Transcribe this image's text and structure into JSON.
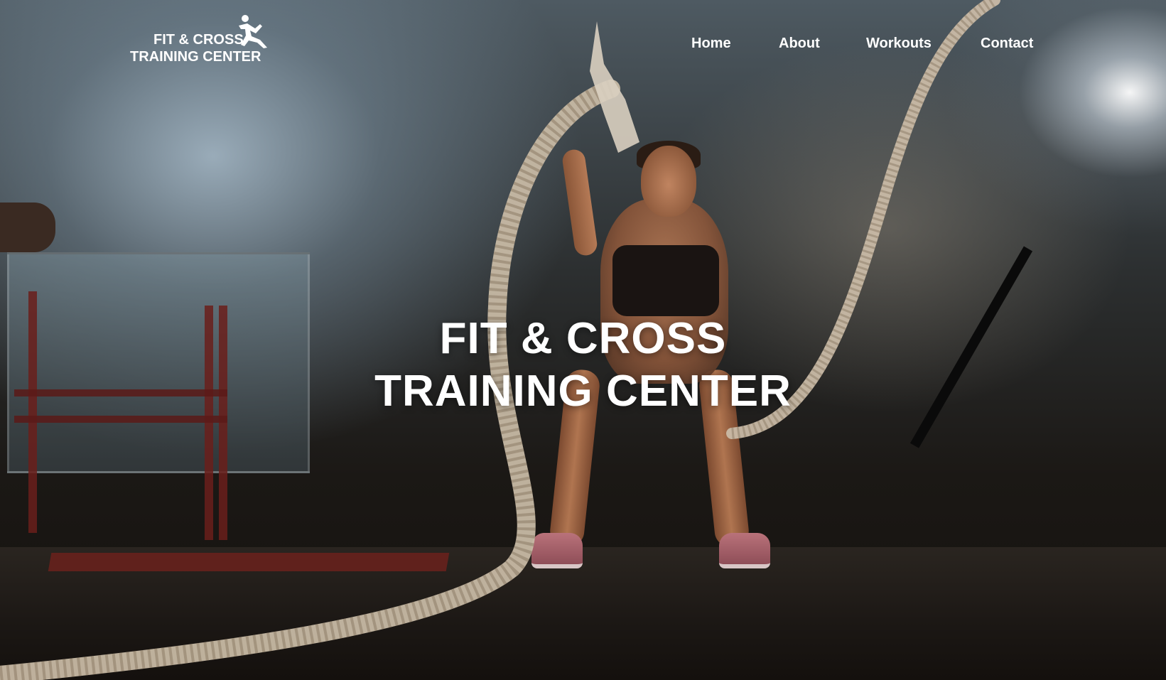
{
  "logo": {
    "line1": "FIT & CROSS",
    "line2": "TRAINING CENTER",
    "icon": "running-person-icon"
  },
  "nav": {
    "items": [
      {
        "label": "Home"
      },
      {
        "label": "About"
      },
      {
        "label": "Workouts"
      },
      {
        "label": "Contact"
      }
    ]
  },
  "hero": {
    "title_line1": "FIT & CROSS",
    "title_line2": "TRAINING CENTER"
  },
  "colors": {
    "text": "#ffffff",
    "background_dark": "#14110e",
    "accent_red": "#6b211c"
  }
}
